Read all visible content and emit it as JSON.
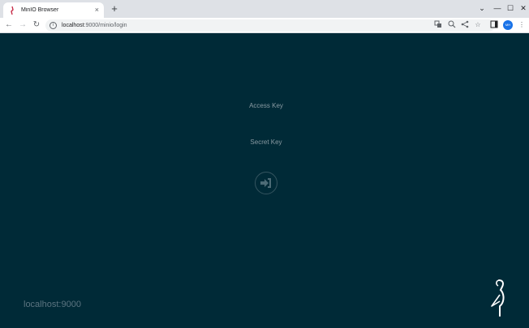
{
  "browser": {
    "tab_title": "MinIO Browser",
    "tab_close": "×",
    "new_tab": "+",
    "url_host": "localhost",
    "url_path": ":9000/minio/login",
    "profile_initials": "MH",
    "controls": {
      "down": "⌄",
      "minimize": "—",
      "maximize": "☐",
      "close": "✕"
    },
    "nav": {
      "back": "←",
      "forward": "→",
      "reload": "↻"
    }
  },
  "login": {
    "access_key_placeholder": "Access Key",
    "secret_key_placeholder": "Secret Key"
  },
  "footer": {
    "host": "localhost:9000"
  },
  "colors": {
    "page_bg": "#002a37",
    "field_text": "#8a9ba3",
    "host_text": "#5b7480",
    "brand_red": "#c72c48"
  }
}
